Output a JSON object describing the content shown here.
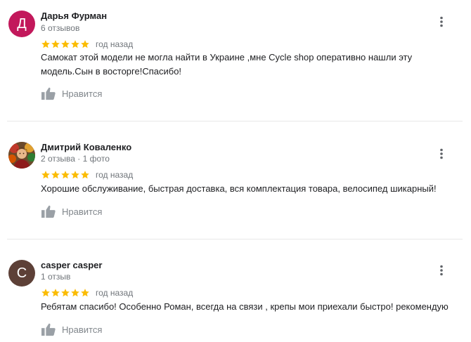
{
  "reviews": [
    {
      "author": "Дарья Фурман",
      "meta": "6 отзывов",
      "avatar_letter": "Д",
      "avatar_color": "#c2185b",
      "rating": 5,
      "date": "год назад",
      "text": "Самокат этой модели не могла найти в Украине ,мне Cycle shop оперативно нашли эту модель.Сын в восторге!Спасибо!",
      "like_label": "Нравится"
    },
    {
      "author": "Дмитрий Коваленко",
      "meta": "2 отзыва · 1 фото",
      "avatar_icon": "user-photo",
      "rating": 5,
      "date": "год назад",
      "text": "Хорошие обслуживание, быстрая доставка, вся комплектация товара, велосипед шикарный!",
      "like_label": "Нравится"
    },
    {
      "author": "casper casper",
      "meta": "1 отзыв",
      "avatar_letter": "C",
      "avatar_color": "#5d4037",
      "rating": 5,
      "date": "год назад",
      "text": "Ребятам спасибо! Особенно Роман, всегда на связи , крепы мои приехали быстро! рекомендую",
      "like_label": "Нравится"
    }
  ],
  "colors": {
    "star": "#fbbc04",
    "like_icon": "#9aa0a6",
    "more_icon": "#5f6368"
  }
}
